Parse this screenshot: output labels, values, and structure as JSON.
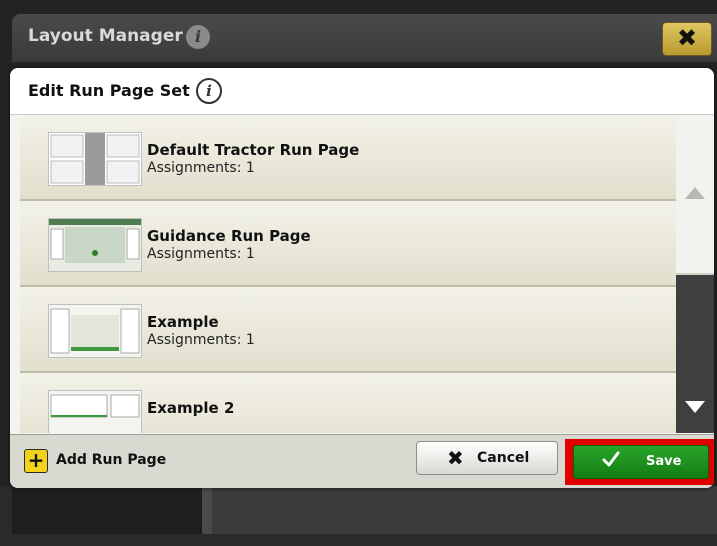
{
  "window": {
    "title": "Layout Manager",
    "close_label": "✖"
  },
  "dialog": {
    "title": "Edit Run Page Set"
  },
  "list": {
    "items": [
      {
        "name": "Default Tractor Run Page",
        "subtitle": "Assignments: 1"
      },
      {
        "name": "Guidance Run Page",
        "subtitle": "Assignments: 1"
      },
      {
        "name": "Example",
        "subtitle": "Assignments: 1"
      },
      {
        "name": "Example 2",
        "subtitle": ""
      }
    ]
  },
  "footer": {
    "add_label": "Add Run Page",
    "cancel_label": "Cancel",
    "save_label": "Save"
  },
  "colors": {
    "save_green": "#1a8f1a",
    "highlight_red": "#e00000",
    "add_yellow": "#f2d31a",
    "close_gold": "#c9ae45"
  },
  "icons": {
    "info": "info-icon",
    "close": "close-icon",
    "add": "plus-icon",
    "cancel": "x-icon",
    "save": "checkmark-icon",
    "scroll_up": "arrow-up-icon",
    "scroll_down": "arrow-down-icon"
  }
}
